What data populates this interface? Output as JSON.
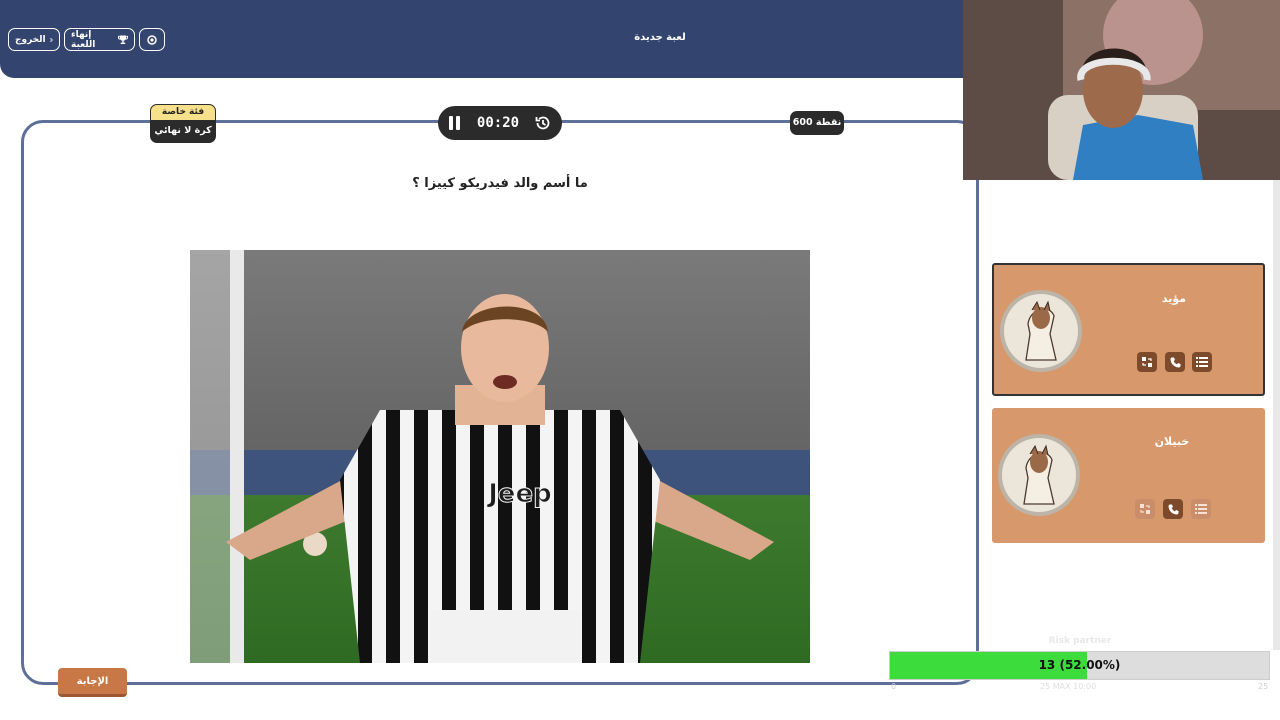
{
  "header": {
    "title": "لعبة جديدة",
    "exit_label": "الخروج",
    "end_game_label": "إنهاء اللعبة",
    "buttons": {
      "exit_icon": "exit-icon",
      "trophy_icon": "trophy-icon",
      "extra_icon": "swirl-icon"
    }
  },
  "question_card": {
    "category_label": "فئة خاصة",
    "category_name": "كرة لا نهائي",
    "timer": "00:20",
    "points": "600 نقطة",
    "question": "ما أسم والد فيدريكو كييزا ؟",
    "answer_button": "الإجابة"
  },
  "teams": [
    {
      "name": "مؤيد",
      "active": true,
      "tools": [
        "list-icon",
        "phone-icon",
        "swap-icon"
      ],
      "tools_used": [
        false,
        false,
        false
      ]
    },
    {
      "name": "خبيلان",
      "active": false,
      "tools": [
        "list-icon",
        "phone-icon",
        "swap-icon"
      ],
      "tools_used": [
        true,
        false,
        true
      ]
    }
  ],
  "progress": {
    "label": "Risk partner",
    "text": "13 (52.00%)",
    "fraction": 0.52,
    "min": "0",
    "max": "25",
    "note": "25 MAX 10:00"
  },
  "colors": {
    "header": "#33446e",
    "card_border": "#5e6f98",
    "team_bg": "#d7986c",
    "answer_button": "#c87847",
    "progress_fill": "#3ddc3d"
  }
}
